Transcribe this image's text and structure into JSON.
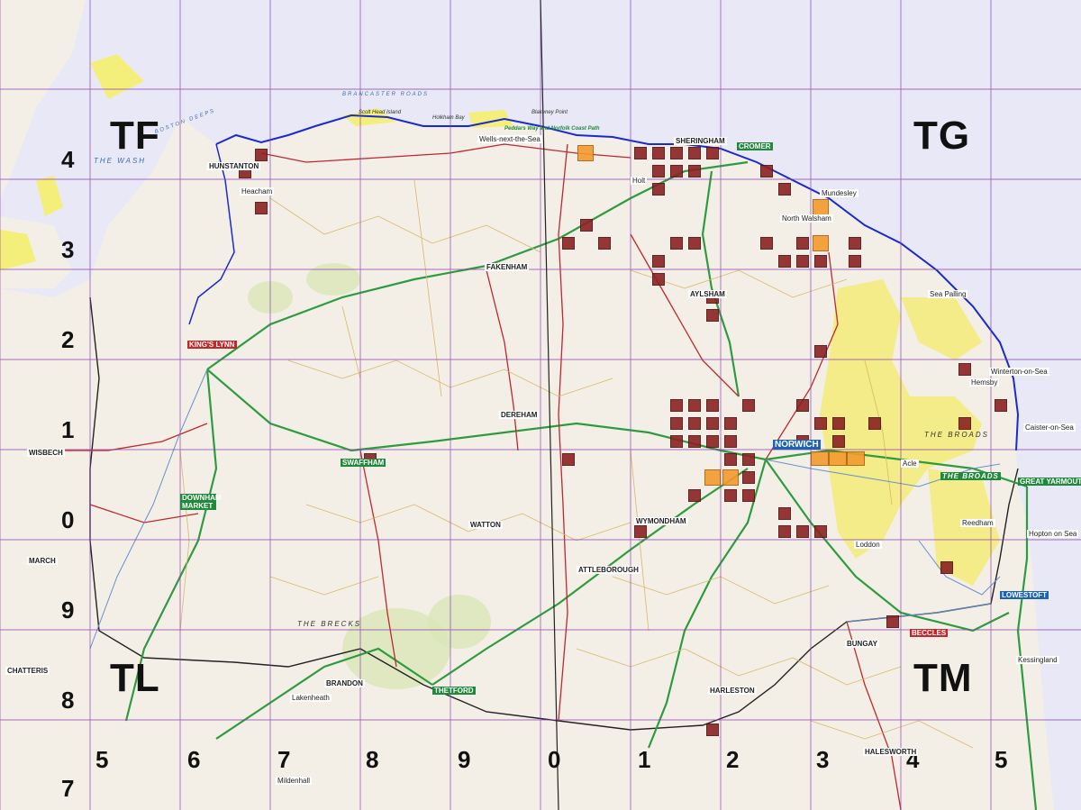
{
  "colors": {
    "sea": "#e8e8f6",
    "land": "#f3efe6",
    "grid": "#8a3db0",
    "coast": "#1a2ad0",
    "record_square": "#8a2222",
    "record_square_recent": "#f29a2e",
    "broads_yellow": "#f2ea3c",
    "sand": "#f4ef7a",
    "road_primary": "#2f9b40",
    "road_a": "#c0282d"
  },
  "map": {
    "grid_letters": [
      {
        "id": "TF",
        "text": "TF"
      },
      {
        "id": "TG",
        "text": "TG"
      },
      {
        "id": "TL",
        "text": "TL"
      },
      {
        "id": "TM",
        "text": "TM"
      }
    ],
    "row_numbers": [
      "4",
      "3",
      "2",
      "1",
      "0",
      "9",
      "8",
      "7"
    ],
    "column_numbers": [
      "5",
      "6",
      "7",
      "8",
      "9",
      "0",
      "1",
      "2",
      "3",
      "4",
      "5"
    ],
    "towns": [
      {
        "id": "hunstanton",
        "text": "HUNSTANTON",
        "style": "plain"
      },
      {
        "id": "kings-lynn",
        "text": "KING'S LYNN",
        "style": "red"
      },
      {
        "id": "fakenham",
        "text": "FAKENHAM",
        "style": "plain"
      },
      {
        "id": "sheringham",
        "text": "SHERINGHAM",
        "style": "plain"
      },
      {
        "id": "cromer",
        "text": "CROMER",
        "style": "green"
      },
      {
        "id": "aylsham",
        "text": "AYLSHAM",
        "style": "plain"
      },
      {
        "id": "dereham",
        "text": "DEREHAM",
        "style": "plain"
      },
      {
        "id": "norwich",
        "text": "NORWICH",
        "style": "blue"
      },
      {
        "id": "swaffham",
        "text": "SWAFFHAM",
        "style": "green"
      },
      {
        "id": "downham-market",
        "text": "DOWNHAM MARKET",
        "style": "green"
      },
      {
        "id": "wymondham",
        "text": "WYMONDHAM",
        "style": "plain"
      },
      {
        "id": "watton",
        "text": "WATTON",
        "style": "plain"
      },
      {
        "id": "attleborough",
        "text": "ATTLEBOROUGH",
        "style": "plain"
      },
      {
        "id": "thetford",
        "text": "THETFORD",
        "style": "green"
      },
      {
        "id": "brandon",
        "text": "BRANDON",
        "style": "plain"
      },
      {
        "id": "great-yarmouth",
        "text": "GREAT YARMOUTH",
        "style": "green"
      },
      {
        "id": "lowestoft",
        "text": "LOWESTOFT",
        "style": "blue"
      },
      {
        "id": "beccles",
        "text": "BECCLES",
        "style": "red"
      },
      {
        "id": "bungay",
        "text": "BUNGAY",
        "style": "plain"
      },
      {
        "id": "harleston",
        "text": "HARLESTON",
        "style": "plain"
      },
      {
        "id": "halesworth",
        "text": "HALESWORTH",
        "style": "plain"
      },
      {
        "id": "wisbech",
        "text": "WISBECH",
        "style": "plain"
      },
      {
        "id": "march",
        "text": "MARCH",
        "style": "plain"
      },
      {
        "id": "chatteris",
        "text": "CHATTERIS",
        "style": "plain"
      },
      {
        "id": "mildenhall",
        "text": "Mildenhall",
        "style": "plain"
      },
      {
        "id": "lakenheath",
        "text": "Lakenheath",
        "style": "plain"
      },
      {
        "id": "kessingland",
        "text": "Kessingland",
        "style": "plain"
      },
      {
        "id": "hopton-on-sea",
        "text": "Hopton on Sea",
        "style": "plain"
      },
      {
        "id": "caister-on-sea",
        "text": "Caister-on-Sea",
        "style": "plain"
      },
      {
        "id": "winterton-on-sea",
        "text": "Winterton-on-Sea",
        "style": "plain"
      },
      {
        "id": "mundesley",
        "text": "Mundesley",
        "style": "plain"
      },
      {
        "id": "sea-palling",
        "text": "Sea Palling",
        "style": "plain"
      },
      {
        "id": "hemsby",
        "text": "Hemsby",
        "style": "plain"
      },
      {
        "id": "reedham",
        "text": "Reedham",
        "style": "plain"
      },
      {
        "id": "loddon",
        "text": "Loddon",
        "style": "plain"
      },
      {
        "id": "acle",
        "text": "Acle",
        "style": "plain"
      },
      {
        "id": "heacham",
        "text": "Heacham",
        "style": "plain"
      },
      {
        "id": "holt",
        "text": "Holt",
        "style": "plain"
      },
      {
        "id": "north-walsham",
        "text": "North Walsham",
        "style": "plain"
      },
      {
        "id": "wells",
        "text": "Wells-next-the-Sea",
        "style": "plain"
      }
    ],
    "areas": [
      {
        "id": "the-wash",
        "text": "THE WASH"
      },
      {
        "id": "the-broads",
        "text": "THE BROADS"
      },
      {
        "id": "the-brecks",
        "text": "THE BRECKS"
      },
      {
        "id": "brancaster-roads",
        "text": "BRANCASTER ROADS"
      },
      {
        "id": "the-broads-2",
        "text": "THE BROADS"
      }
    ],
    "coast_features": [
      {
        "id": "scolt-head",
        "text": "Scolt Head Island"
      },
      {
        "id": "blakeney-point",
        "text": "Blakeney Point"
      },
      {
        "id": "peddars-way",
        "text": "Peddars Way and Norfolk Coast Path"
      },
      {
        "id": "holkham-bay",
        "text": "Holkham Bay"
      },
      {
        "id": "boston-deeps",
        "text": "BOSTON DEEPS"
      }
    ]
  }
}
